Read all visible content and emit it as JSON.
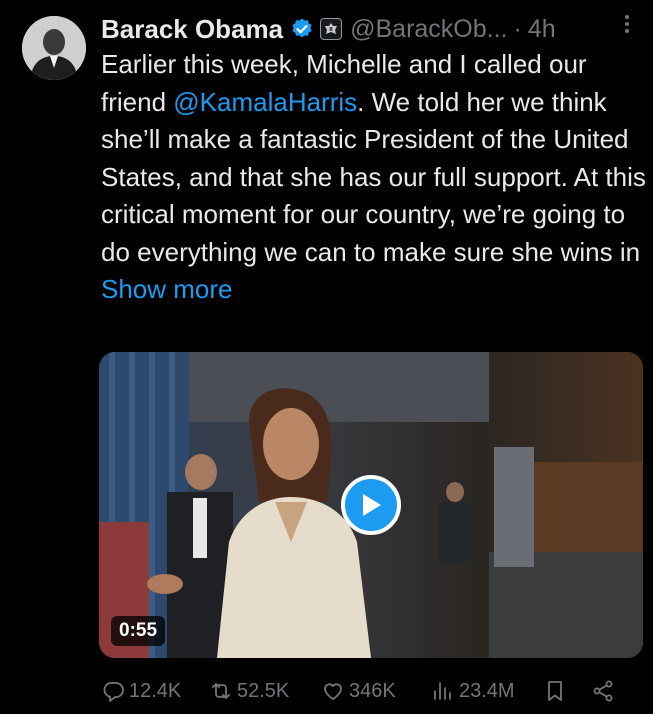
{
  "author": {
    "name": "Barack Obama",
    "handle": "@BarackOb...",
    "separator": "·",
    "time": "4h"
  },
  "tweet": {
    "text_before_mention": "Earlier this week, Michelle and I called our friend ",
    "mention": "@KamalaHarris",
    "text_after_mention": ". We told her we think she’ll make a fantastic President of the United States, and that she has our full support. At this critical moment for our country, we’re going to do everything we can to make sure she wins in ",
    "show_more": "Show more"
  },
  "media": {
    "duration": "0:55"
  },
  "actions": {
    "replies": "12.4K",
    "reposts": "52.5K",
    "likes": "346K",
    "views": "23.4M"
  },
  "colors": {
    "background": "#000000",
    "text": "#e7e9ea",
    "muted": "#71767b",
    "accent": "#1d9bf0"
  },
  "icons": [
    "verified-badge-icon",
    "government-seal-icon",
    "more-options-icon",
    "play-icon",
    "reply-icon",
    "repost-icon",
    "like-icon",
    "views-icon",
    "bookmark-icon",
    "share-icon"
  ]
}
